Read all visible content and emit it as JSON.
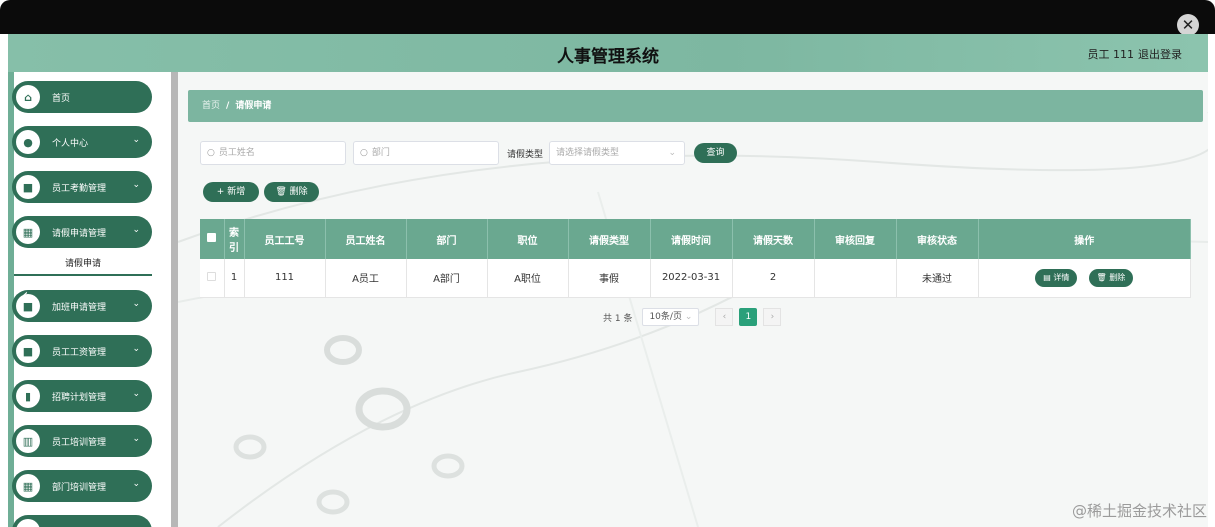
{
  "window": {
    "close_symbol": "✕"
  },
  "header": {
    "title": "人事管理系统",
    "user": "员工 111",
    "logout": "退出登录"
  },
  "sidebar": {
    "items": [
      {
        "label": "首页",
        "icon": "home-icon",
        "glyph": "⌂",
        "arrow": false
      },
      {
        "label": "个人中心",
        "icon": "user-icon",
        "glyph": "●",
        "arrow": true
      },
      {
        "label": "员工考勤管理",
        "icon": "clipboard-icon",
        "glyph": "■",
        "arrow": true
      },
      {
        "label": "请假申请管理",
        "icon": "grid-icon",
        "glyph": "▦",
        "arrow": true
      },
      {
        "label": "加班申请管理",
        "icon": "clipboard-icon",
        "glyph": "■",
        "arrow": true
      },
      {
        "label": "员工工资管理",
        "icon": "clipboard-icon",
        "glyph": "■",
        "arrow": true
      },
      {
        "label": "招聘计划管理",
        "icon": "chart-icon",
        "glyph": "▮",
        "arrow": true
      },
      {
        "label": "员工培训管理",
        "icon": "bar-chart-icon",
        "glyph": "▥",
        "arrow": true
      },
      {
        "label": "部门培训管理",
        "icon": "grid-icon",
        "glyph": "▦",
        "arrow": true
      }
    ],
    "submenu_active": "请假申请",
    "arrow_glyph": "⌄",
    "collapse_glyph": "‹"
  },
  "breadcrumb": {
    "home": "首页",
    "sep": "/",
    "current": "请假申请"
  },
  "search": {
    "name_placeholder": "员工姓名",
    "dept_placeholder": "部门",
    "leave_type_label": "请假类型",
    "leave_type_placeholder": "请选择请假类型",
    "query_button": "查询"
  },
  "actions": {
    "add": "新增",
    "add_icon": "+",
    "delete": "删除",
    "delete_icon": "🗑"
  },
  "table": {
    "headers": [
      "索引",
      "员工工号",
      "员工姓名",
      "部门",
      "职位",
      "请假类型",
      "请假时间",
      "请假天数",
      "审核回复",
      "审核状态",
      "操作"
    ],
    "rows": [
      {
        "index": "1",
        "emp_no": "111",
        "name": "A员工",
        "dept": "A部门",
        "position": "A职位",
        "type": "事假",
        "date": "2022-03-31",
        "days": "2",
        "reply": "",
        "status": "未通过"
      }
    ],
    "row_buttons": {
      "detail": "详情",
      "delete": "删除"
    }
  },
  "pagination": {
    "total": "共 1 条",
    "page_size": "10条/页",
    "current_page": "1",
    "prev": "‹",
    "next": "›"
  },
  "watermark": "@稀土掘金技术社区",
  "colors": {
    "accent": "#2f6f57",
    "header": "#7cb5a0",
    "table_header": "#6aa890",
    "active_page": "#2aa07a"
  }
}
